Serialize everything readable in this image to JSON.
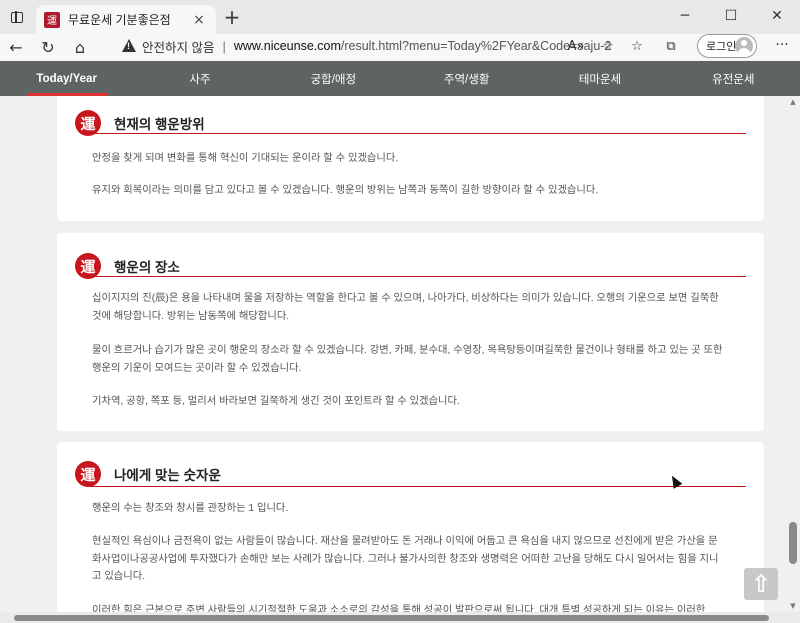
{
  "browser": {
    "tab_title": "무료운세 기분좋은점",
    "tab_favicon": "運",
    "tab_close": "×",
    "new_tab": "+",
    "security_text": "안전하지 않음",
    "url_domain": "www.niceunse.com",
    "url_path": "/result.html?menu=Today%2FYear&Code=saju-2",
    "login_label": "로그인",
    "back_icon": "←",
    "reload_icon": "↻",
    "home_icon": "⌂",
    "more_icon": "···"
  },
  "site_nav": {
    "items": [
      {
        "label": "Today/Year",
        "active": true
      },
      {
        "label": "사주",
        "active": false
      },
      {
        "label": "궁합/애정",
        "active": false
      },
      {
        "label": "주역/생활",
        "active": false
      },
      {
        "label": "테마운세",
        "active": false
      },
      {
        "label": "유전운세",
        "active": false
      }
    ]
  },
  "sections": [
    {
      "seal": "運",
      "title": "현재의 행운방위",
      "paragraphs": [
        "안정을 찾게 되며 변화를 통해 혁신이 기대되는 운이라 할 수 있겠습니다.",
        "유지와 회복이라는 의미를 담고 있다고 볼 수 있겠습니다. 행운의 방위는 남쪽과 동쪽이 길한 방향이라 할 수 있겠습니다."
      ]
    },
    {
      "seal": "運",
      "title": "행운의 장소",
      "paragraphs": [
        "십이지지의 진(辰)은 용을 나타내며 물을 저장하는 역할을 한다고 볼 수 있으며, 나아가다, 비상하다는 의미가 있습니다. 오행의 기운으로 보면 길쭉한 것에 해당합니다. 방위는 남동쪽에 해당합니다.",
        "물이 흐르거나 습기가 많은 곳이 행운의 장소라 할 수 있겠습니다. 강변, 카페, 분수대, 수영장, 목욕탕등이며길쭉한 물건이나 형태를 하고 있는 곳 또한 행운의 기운이 모여드는 곳이라 할 수 있겠습니다.",
        "기차역, 공항, 쪽포 등, 멀리서 바라보면 길쭉하게 생긴 것이 포인트라 할 수 있겠습니다."
      ]
    },
    {
      "seal": "運",
      "title": "나에게 맞는 숫자운",
      "paragraphs": [
        "행운의 수는 창조와 창시를 관장하는 1 입니다.",
        "현실적인 욕심이나 금전욕이 없는 사람들이 많습니다. 재산을 물려받아도 돈 거래나 이익에 어둡고 큰 욕심을 내지 않으므로 선친에게 받은 가산을 문화사업이나공공사업에 투자했다가 손해만 보는 사례가 많습니다. 그러나 불가사의한 창조와 생명력은 어떠한 고난을 당해도 다시 일어서는 힘을 지니고 있습니다.",
        "이러한 힘은 근본으로 주변 사람들의 시기적절한 도움과 소소로의 감성을 통해 성공이 발판으로써 됩니다. 대개 특별 성공하게 되는 이유는 이러한"
      ]
    }
  ],
  "scroll_top_label": "⇧"
}
